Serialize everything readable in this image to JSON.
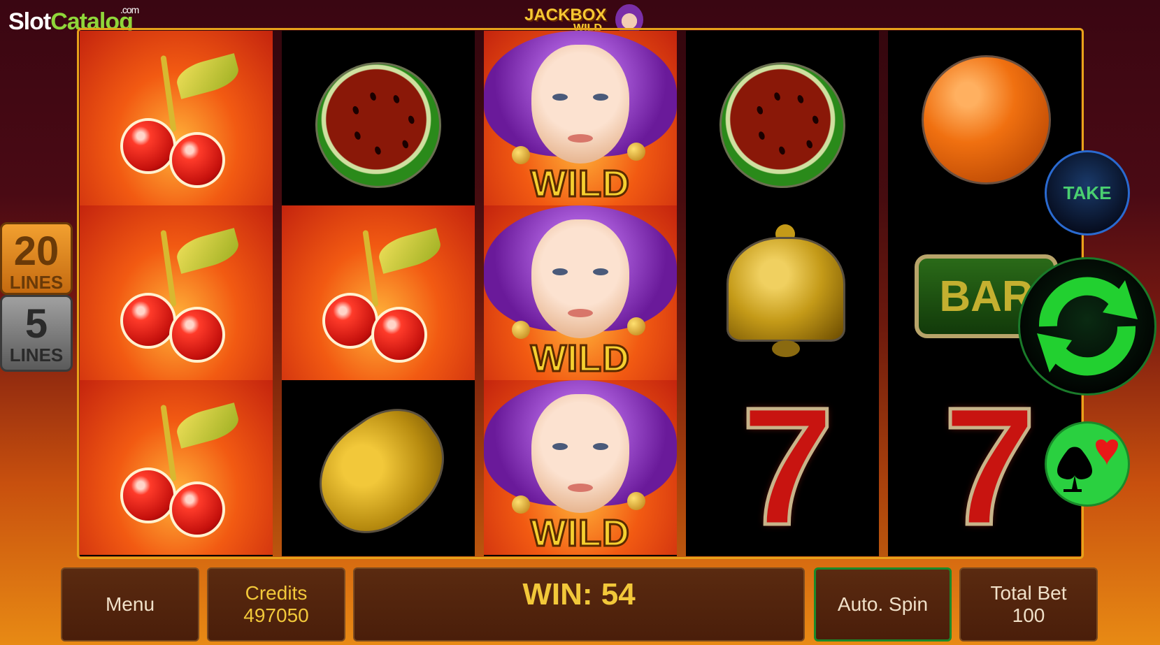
{
  "watermark": {
    "slot": "Slot",
    "catalog": "Catalog",
    "com": ".com"
  },
  "logo": {
    "title": "JACKBOX",
    "subtitle": "WILD"
  },
  "lines_badges": [
    {
      "number": "20",
      "label": "LINES"
    },
    {
      "number": "5",
      "label": "LINES"
    }
  ],
  "reels": [
    [
      "cherry",
      "cherry",
      "cherry"
    ],
    [
      "watermelon",
      "cherry",
      "lemon"
    ],
    [
      "wild",
      "wild",
      "wild"
    ],
    [
      "watermelon",
      "bell",
      "seven"
    ],
    [
      "orange",
      "bar",
      "seven"
    ]
  ],
  "symbols": {
    "bar_text": "BAR",
    "seven_text": "7",
    "wild_text": "WILD"
  },
  "buttons": {
    "take": "TAKE",
    "menu": "Menu",
    "auto_spin": "Auto. Spin"
  },
  "credits": {
    "label": "Credits",
    "value": "497050"
  },
  "win": {
    "text": "WIN: 54"
  },
  "total_bet": {
    "label": "Total Bet",
    "value": "100"
  },
  "colors": {
    "frame": "#e8a21a",
    "accent_green": "#2ad040",
    "gold_text": "#f2c83a"
  }
}
